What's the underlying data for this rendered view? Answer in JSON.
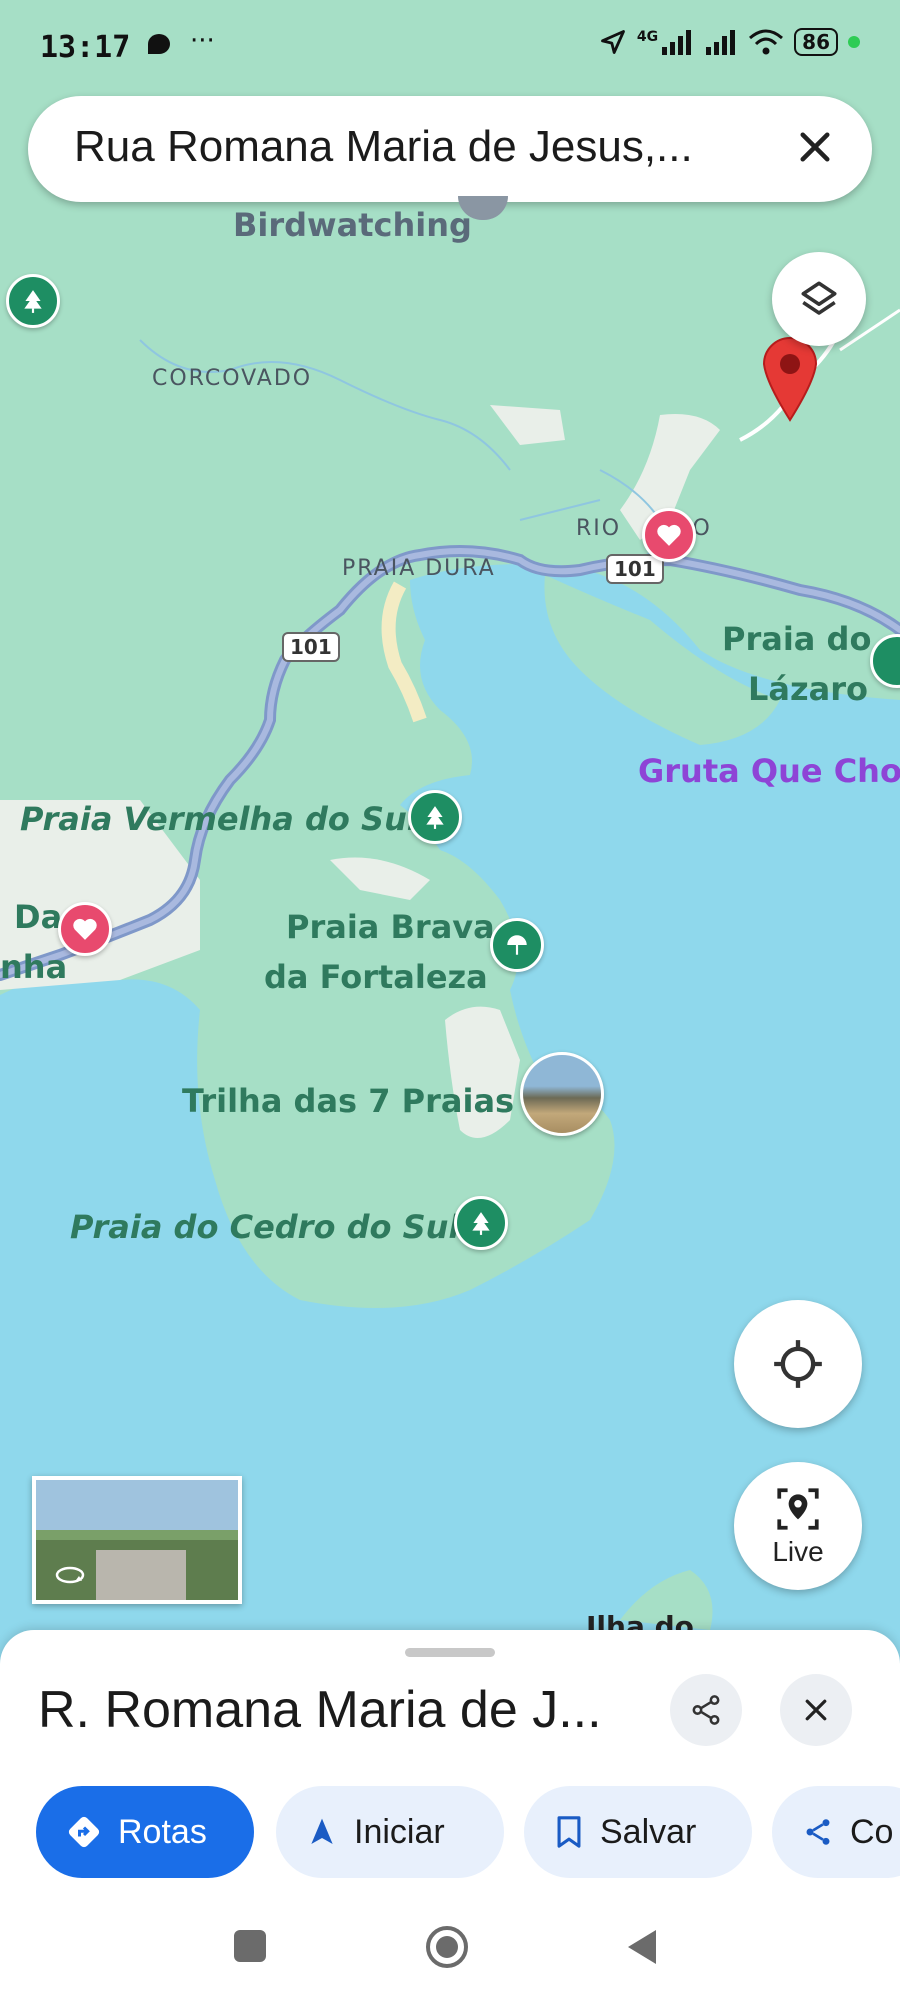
{
  "status_bar": {
    "time": "13:17",
    "battery": "86",
    "network": "4G"
  },
  "search": {
    "value": "Rua Romana Maria de Jesus,..."
  },
  "map_labels": {
    "birdwatching": "Birdwatching",
    "corcovado": "CORCOVADO",
    "praia_dura": "PRAIA DURA",
    "rio_escuro": "RIO    URO",
    "route_101a": "101",
    "route_101b": "101",
    "praia_do_lazaro_1": "Praia do",
    "praia_do_lazaro_2": "Lázaro",
    "gruta": "Gruta Que Chor",
    "praia_vermelha": "Praia Vermelha do Sul",
    "da_left": "Da",
    "nha_left": "nha",
    "praia_brava_1": "Praia Brava",
    "praia_brava_2": "da Fortaleza",
    "trilha": "Trilha das 7 Praias",
    "praia_cedro": "Praia do Cedro do Sul",
    "ilha": "Ilha do"
  },
  "controls": {
    "live_label": "Live"
  },
  "sheet": {
    "title": "R. Romana Maria de J...",
    "actions": [
      {
        "label": "Rotas",
        "icon": "directions-icon"
      },
      {
        "label": "Iniciar",
        "icon": "navigation-arrow-icon"
      },
      {
        "label": "Salvar",
        "icon": "bookmark-icon"
      },
      {
        "label": "Co",
        "icon": "share-icon"
      }
    ]
  },
  "colors": {
    "land": "#a6dfc6",
    "water": "#8fd8ec",
    "road": "#7f98c9",
    "primary": "#1a6ee8",
    "pin_red": "#e53935",
    "pin_green": "#1e8e63",
    "heart": "#e84a6e"
  }
}
